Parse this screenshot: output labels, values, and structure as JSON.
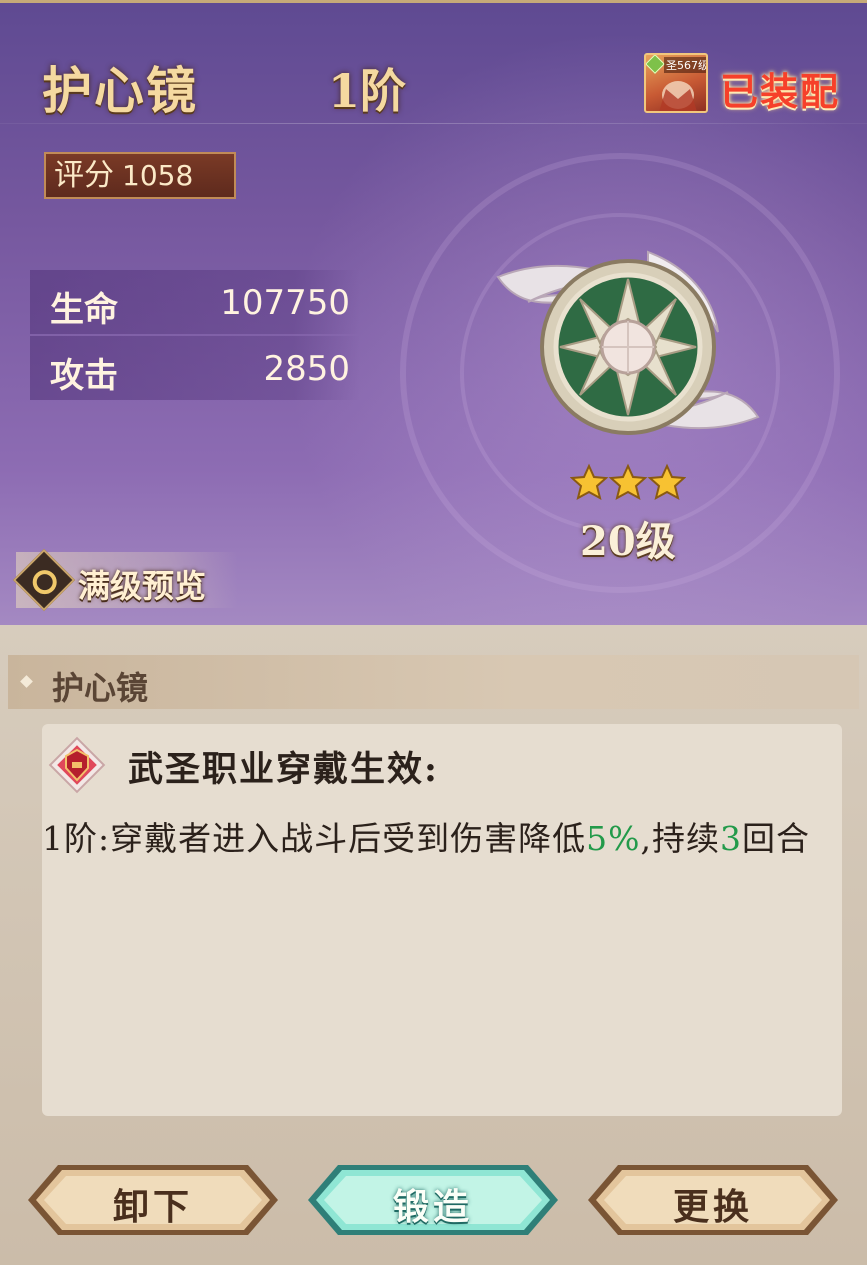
{
  "item": {
    "name": "护心镜",
    "tier": "1阶",
    "status": "已装配",
    "owner_level_badge": "圣567级",
    "score_label": "评分",
    "score_value": "1058",
    "stars": 3,
    "level": "20级"
  },
  "stats": [
    {
      "name": "生命",
      "value": "107750"
    },
    {
      "name": "攻击",
      "value": "2850"
    }
  ],
  "preview_label": "满级预览",
  "section": {
    "name": "护心镜",
    "requirement": "武圣职业穿戴生效:",
    "effect_prefix": "1阶:穿戴者进入战斗后受到伤害降低",
    "effect_value": "5%",
    "effect_middle": ",持续",
    "effect_turns": "3",
    "effect_suffix": "回合"
  },
  "buttons": {
    "unequip": "卸下",
    "forge": "锻造",
    "replace": "更换"
  },
  "colors": {
    "panel_purple": "#76589f",
    "gold_text": "#f5d9a0",
    "equipped_red": "#f6402a",
    "highlight_green": "#239a4a",
    "forge_teal": "#5fd3c0",
    "button_bronze": "#c99a66"
  }
}
